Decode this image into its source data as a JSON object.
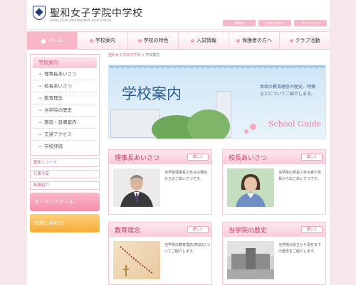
{
  "header": {
    "title": "聖和女子学院中学校",
    "subtitle": "SEIWA JOSHI GAKUIN JUNIOR HIGH SCHOOL",
    "util_links": [
      "事務局",
      "お問い合わせ",
      "サイトマップ"
    ]
  },
  "nav": [
    {
      "label": "ホーム",
      "icon": "house-icon"
    },
    {
      "label": "学校案内"
    },
    {
      "label": "学校の特色"
    },
    {
      "label": "入試情報"
    },
    {
      "label": "保護者の方へ"
    },
    {
      "label": "クラブ活動"
    }
  ],
  "breadcrumb": {
    "home": "聖和女子学院中学校",
    "separator": ">",
    "current": "学校案内"
  },
  "sidebar": {
    "heading": "学校案内",
    "items": [
      {
        "label": "理事長あいさつ"
      },
      {
        "label": "校長あいさつ"
      },
      {
        "label": "教育理念"
      },
      {
        "label": "当学院の歴史"
      },
      {
        "label": "施設・設備案内"
      },
      {
        "label": "交通アクセス"
      },
      {
        "label": "学校評価"
      }
    ],
    "links": [
      "聖和ニュース",
      "行事予定",
      "制服紹介"
    ],
    "banners": [
      "オープンスクール",
      "お問い合わせ"
    ]
  },
  "hero": {
    "title": "学校案内",
    "text": "本校の教育理念や歴史、特徴などについてご紹介します。",
    "english": "School Guide"
  },
  "cards": [
    {
      "title": "理事長あいさつ",
      "more": "詳しく",
      "text": "当学院理事長である白瀬信からのごあいさつです。",
      "image": "chairman-portrait"
    },
    {
      "title": "校長あいさつ",
      "more": "詳しく",
      "text": "当学院の校長である森下校長からのごあいさつです。",
      "image": "principal-portrait"
    },
    {
      "title": "教育理念",
      "more": "詳しく",
      "text": "当学院の教育理念(校訓)についてご紹介します。",
      "image": "rosary-photo"
    },
    {
      "title": "当学院の歴史",
      "more": "詳しく",
      "text": "当学院の設立から現在までの歴史をご紹介します。",
      "image": "old-school-photo"
    }
  ],
  "colors": {
    "accent_pink": "#f7b7c8",
    "title_pink": "#c23f69",
    "hero_blue": "#2b5d94"
  }
}
